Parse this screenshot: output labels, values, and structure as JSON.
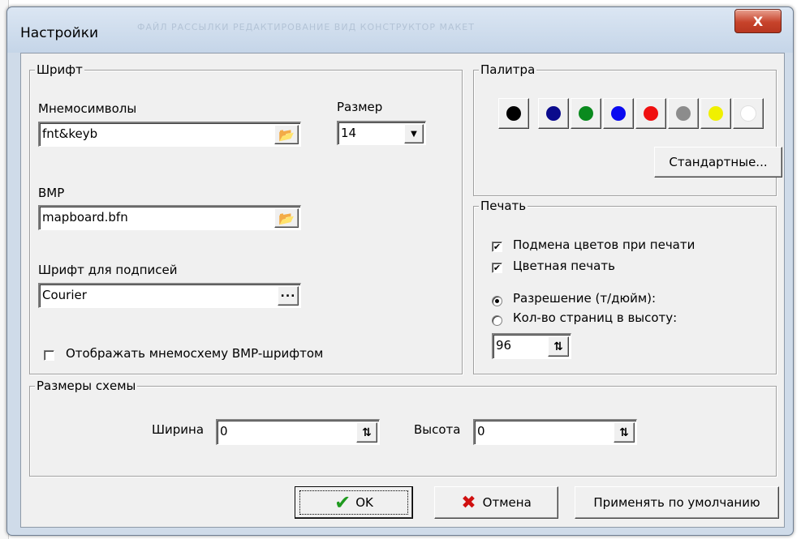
{
  "window": {
    "title": "Настройки",
    "close_label": "X"
  },
  "font_group": {
    "legend": "Шрифт",
    "mnemo_label": "Мнемосимволы",
    "mnemo_value": "fnt&keyb",
    "size_label": "Размер",
    "size_value": "14",
    "bmp_label": "BMP",
    "bmp_value": "mapboard.bfn",
    "caption_font_label": "Шрифт для подписей",
    "caption_font_value": "Courier",
    "browse_dots": "...",
    "bmp_checkbox_label": "Отображать мнемосхему BMP-шрифтом",
    "bmp_checkbox_checked": false
  },
  "palette_group": {
    "legend": "Палитра",
    "colors": [
      "#000000",
      "#0a0a8c",
      "#0a8a1e",
      "#0a0af0",
      "#f01010",
      "#8c8c8c",
      "#f0f000",
      "#ffffff"
    ],
    "standard_button": "Стандартные..."
  },
  "print_group": {
    "legend": "Печать",
    "swap_colors_label": "Подмена цветов при печати",
    "swap_colors_checked": true,
    "color_print_label": "Цветная печать",
    "color_print_checked": true,
    "resolution_label": "Разрешение (т/дюйм):",
    "resolution_selected": true,
    "pages_label": "Кол-во страниц в высоту:",
    "pages_selected": false,
    "value": "96"
  },
  "scheme_group": {
    "legend": "Размеры схемы",
    "width_label": "Ширина",
    "width_value": "0",
    "height_label": "Высота",
    "height_value": "0"
  },
  "buttons": {
    "ok": "OK",
    "cancel": "Отмена",
    "default": "Применять по умолчанию"
  }
}
